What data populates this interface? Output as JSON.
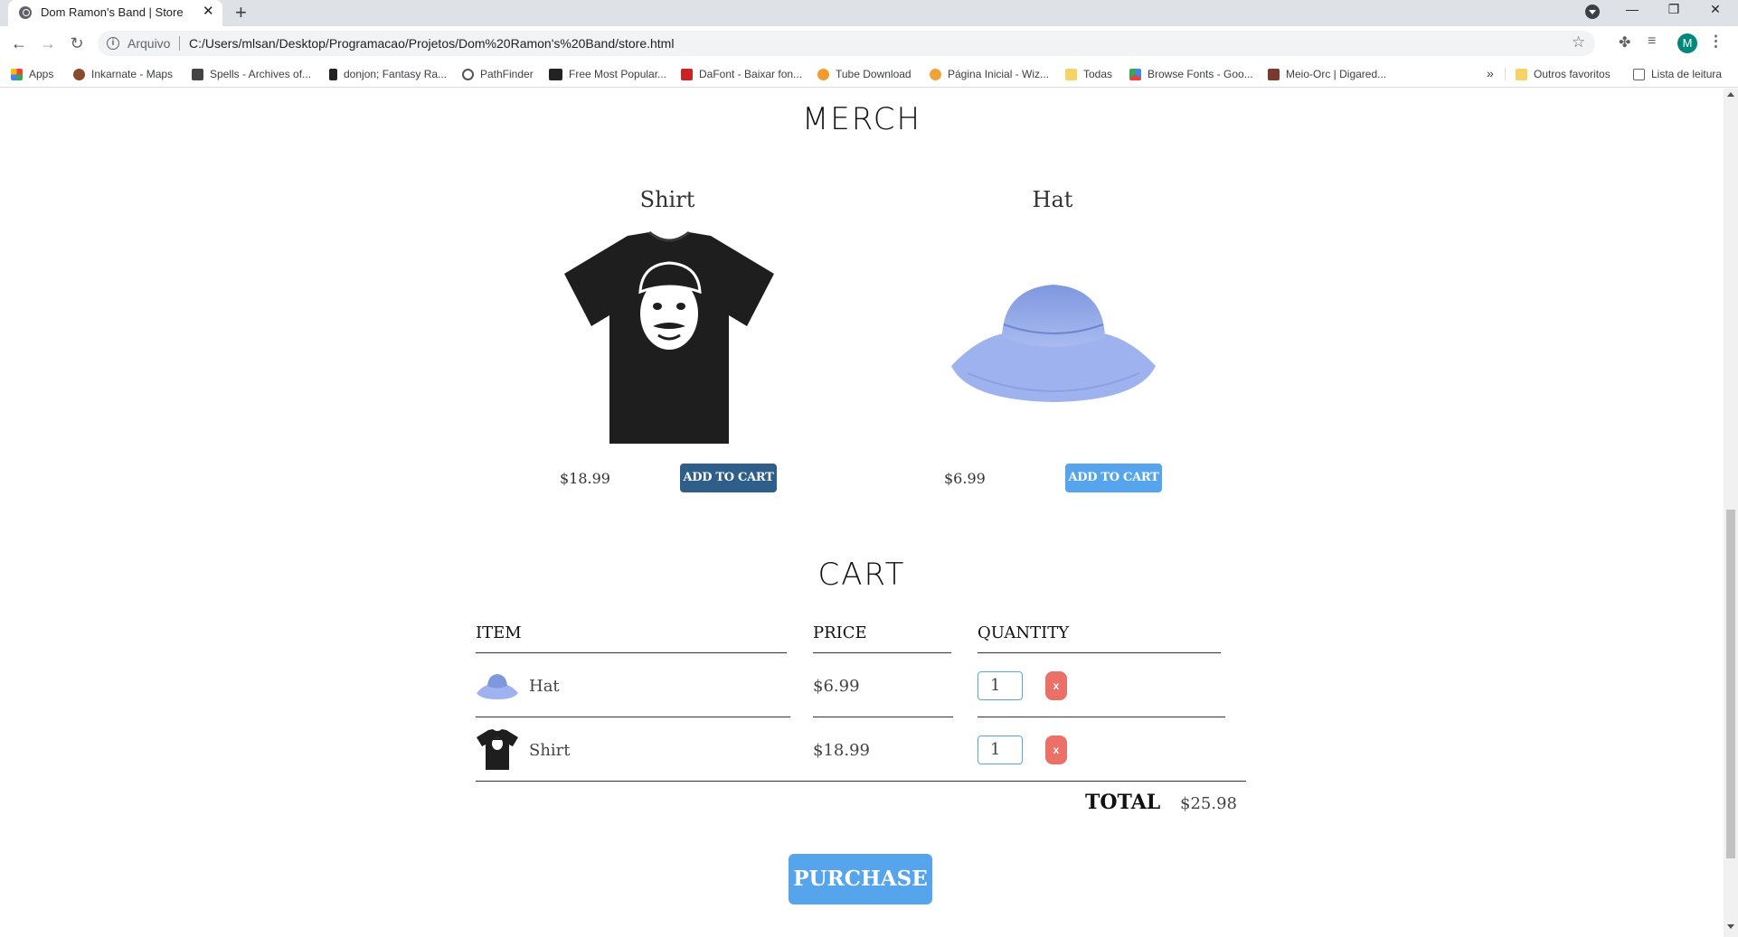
{
  "browser": {
    "tab_title": "Dom Ramon's Band | Store",
    "tab_close": "✕",
    "new_tab": "+",
    "window_min": "—",
    "window_max": "❐",
    "window_close": "✕",
    "origin_chip": "Arquivo",
    "url": "C:/Users/mlsan/Desktop/Programacao/Projetos/Dom%20Ramon's%20Band/store.html",
    "avatar_letter": "M",
    "nav_back": "←",
    "nav_forward": "→",
    "nav_reload": "↻",
    "info": "i",
    "star": "☆",
    "extensions": "✤",
    "media": "≡",
    "menu": "⋮"
  },
  "bookmarks": {
    "items": [
      {
        "label": "Apps",
        "icon": "apps-grid-icon",
        "color": "#e8453c"
      },
      {
        "label": "Inkarnate - Maps",
        "icon": "inkarnate-icon",
        "color": "#8b4a2b"
      },
      {
        "label": "Spells - Archives of...",
        "icon": "spells-icon",
        "color": "#444444"
      },
      {
        "label": "donjon; Fantasy Ra...",
        "icon": "donjon-icon",
        "color": "#222222"
      },
      {
        "label": "PathFinder",
        "icon": "pathfinder-icon",
        "color": "#555555"
      },
      {
        "label": "Free Most Popular...",
        "icon": "pd-icon",
        "color": "#222222"
      },
      {
        "label": "DaFont - Baixar fon...",
        "icon": "dafont-icon",
        "color": "#cc2222"
      },
      {
        "label": "Tube Download",
        "icon": "tube-download-icon",
        "color": "#f29a2e"
      },
      {
        "label": "Página Inicial - Wiz...",
        "icon": "wiz-icon",
        "color": "#f2a23a"
      },
      {
        "label": "Todas",
        "icon": "folder-icon",
        "color": "#f6d365"
      },
      {
        "label": "Browse Fonts - Goo...",
        "icon": "google-fonts-icon",
        "color": "#4285f4"
      },
      {
        "label": "Meio-Orc | Digared...",
        "icon": "meio-orc-icon",
        "color": "#7a3b2e"
      }
    ],
    "more": "»",
    "other_favorites": "Outros favoritos",
    "reading_list": "Lista de leitura"
  },
  "store": {
    "merch_title": "MERCH",
    "cart_title": "CART",
    "products": [
      {
        "name": "Shirt",
        "price": "$18.99",
        "button": "ADD TO CART",
        "button_color": "#2d5f8a"
      },
      {
        "name": "Hat",
        "price": "$6.99",
        "button": "ADD TO CART",
        "button_color": "#56a5ec"
      }
    ],
    "cart": {
      "headers": {
        "item": "ITEM",
        "price": "PRICE",
        "quantity": "QUANTITY"
      },
      "rows": [
        {
          "name": "Hat",
          "price": "$6.99",
          "quantity": "1",
          "remove": "x"
        },
        {
          "name": "Shirt",
          "price": "$18.99",
          "quantity": "1",
          "remove": "x"
        }
      ],
      "total_label": "TOTAL",
      "total_price": "$25.98",
      "purchase": "PURCHASE"
    },
    "colors": {
      "accent": "#56a5ec",
      "accent_dark": "#2d5f8a",
      "remove": "#eb7068",
      "hat": "#8fa8ea"
    }
  }
}
